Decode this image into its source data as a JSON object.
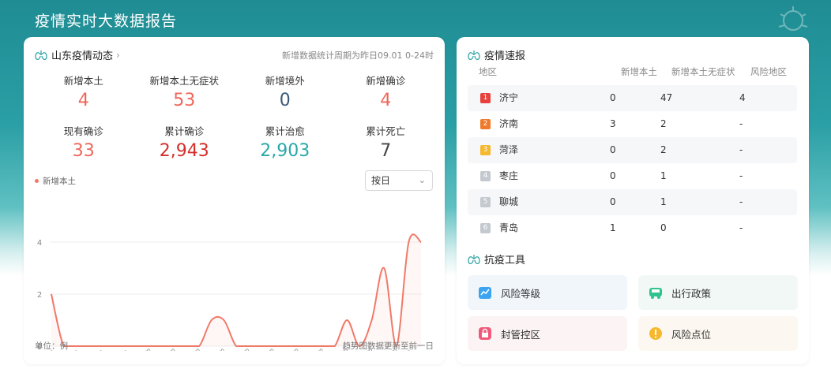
{
  "page": {
    "title": "疫情实时大数据报告"
  },
  "dynamics": {
    "title": "山东疫情动态",
    "period": "新增数据统计周期为昨日09.01 0-24时",
    "stats": [
      {
        "label": "新增本土",
        "value": "4",
        "color": "#f0665a"
      },
      {
        "label": "新增本土无症状",
        "value": "53",
        "color": "#f0665a"
      },
      {
        "label": "新增境外",
        "value": "0",
        "color": "#3a5a78"
      },
      {
        "label": "新增确诊",
        "value": "4",
        "color": "#f0665a"
      },
      {
        "label": "现有确诊",
        "value": "33",
        "color": "#f0665a"
      },
      {
        "label": "累计确诊",
        "value": "2,943",
        "color": "#d4302b"
      },
      {
        "label": "累计治愈",
        "value": "2,903",
        "color": "#2aa8a8"
      },
      {
        "label": "累计死亡",
        "value": "7",
        "color": "#444444"
      }
    ],
    "legend": "新增本土",
    "select_value": "按日",
    "unit_note": "单位：例",
    "trend_note": "趋势图数据更新至前一日"
  },
  "chart_data": {
    "type": "line",
    "x": [
      "8.3",
      "8.4",
      "8.5",
      "8.6",
      "8.7",
      "8.8",
      "8.9",
      "8.10",
      "8.11",
      "8.12",
      "8.13",
      "8.14",
      "8.15",
      "8.16",
      "8.17",
      "8.18",
      "8.19",
      "8.20",
      "8.21",
      "8.22",
      "8.23",
      "8.24",
      "8.25",
      "8.26",
      "8.27",
      "8.28",
      "8.29",
      "8.30",
      "8.31",
      "9.1"
    ],
    "xticks": [
      "8.3",
      "8.5",
      "8.7",
      "8.9",
      "8.11",
      "8.13",
      "8.15",
      "8.17",
      "8.19",
      "8.21",
      "8.23",
      "8.25",
      "8.27",
      "8.29",
      "8.31",
      "9.1"
    ],
    "series": [
      {
        "values": [
          2,
          0,
          0,
          0,
          0,
          0,
          0,
          0,
          0,
          0,
          0,
          0,
          0,
          1,
          1,
          0,
          0,
          0,
          0,
          0,
          0,
          0,
          0,
          0,
          1,
          0,
          1,
          3,
          0,
          4,
          4
        ]
      }
    ],
    "yticks": [
      "0",
      "2",
      "4"
    ],
    "ylim": [
      0,
      4
    ],
    "color": "#f07a6a",
    "grid": true
  },
  "express": {
    "title": "疫情速报",
    "headers": [
      "地区",
      "新增本土",
      "新增本土无症状",
      "风险地区"
    ],
    "rows": [
      {
        "rank": "1",
        "city": "济宁",
        "local": "0",
        "asym": "47",
        "risk": "4",
        "color": "#e8403a"
      },
      {
        "rank": "2",
        "city": "济南",
        "local": "3",
        "asym": "2",
        "risk": "-",
        "color": "#f07a2a"
      },
      {
        "rank": "3",
        "city": "菏泽",
        "local": "0",
        "asym": "2",
        "risk": "-",
        "color": "#f5b82e"
      },
      {
        "rank": "4",
        "city": "枣庄",
        "local": "0",
        "asym": "1",
        "risk": "-",
        "color": "#c4c8cf"
      },
      {
        "rank": "5",
        "city": "聊城",
        "local": "0",
        "asym": "1",
        "risk": "-",
        "color": "#c4c8cf"
      },
      {
        "rank": "6",
        "city": "青岛",
        "local": "1",
        "asym": "0",
        "risk": "-",
        "color": "#c4c8cf"
      }
    ]
  },
  "tools": {
    "title": "抗疫工具",
    "items": [
      {
        "label": "风险等级",
        "icon": "risk-level-icon",
        "bg": "#f1f6fb"
      },
      {
        "label": "出行政策",
        "icon": "travel-policy-icon",
        "bg": "#f2f8f5"
      },
      {
        "label": "封管控区",
        "icon": "lockdown-zone-icon",
        "bg": "#fcf4f4"
      },
      {
        "label": "风险点位",
        "icon": "risk-point-icon",
        "bg": "#fcf8f1"
      }
    ]
  }
}
